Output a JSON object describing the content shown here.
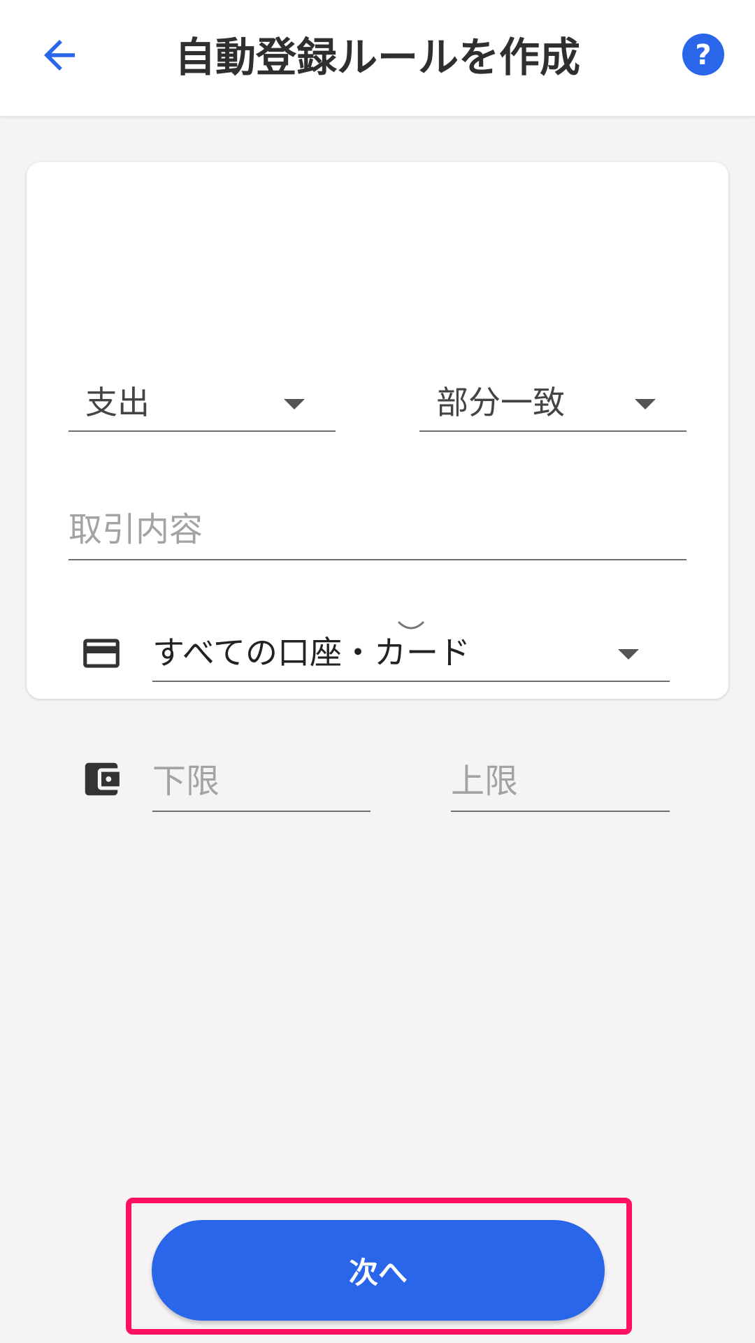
{
  "header": {
    "title": "自動登録ルールを作成",
    "back_icon": "arrow-left-icon",
    "help_icon": "help-circle-icon",
    "accent_color": "#2a66ea"
  },
  "form": {
    "type_select": {
      "value": "支出"
    },
    "match_select": {
      "value": "部分一致"
    },
    "description_input": {
      "placeholder": "取引内容"
    },
    "account_select": {
      "icon": "credit-card-icon",
      "value": "すべての口座・カード"
    },
    "amount": {
      "icon": "wallet-icon",
      "min_placeholder": "下限",
      "max_placeholder": "上限"
    }
  },
  "footer": {
    "next_label": "次へ",
    "highlight_color": "#ff1062"
  }
}
